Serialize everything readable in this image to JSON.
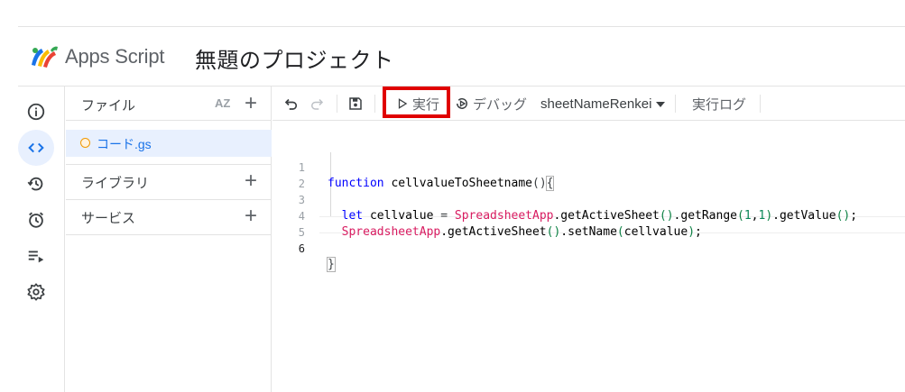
{
  "app": {
    "name": "Apps Script",
    "project_title": "無題のプロジェクト"
  },
  "rail": {
    "items": [
      {
        "icon": "info-icon",
        "active": false
      },
      {
        "icon": "code-editor-icon",
        "active": true
      },
      {
        "icon": "history-icon",
        "active": false
      },
      {
        "icon": "alarm-trigger-icon",
        "active": false
      },
      {
        "icon": "executions-icon",
        "active": false
      },
      {
        "icon": "settings-gear-icon",
        "active": false
      }
    ]
  },
  "files_panel": {
    "header_label": "ファイル",
    "sort_label": "AZ",
    "files": [
      {
        "name": "コード.gs",
        "selected": true
      }
    ],
    "sections": [
      {
        "label": "ライブラリ"
      },
      {
        "label": "サービス"
      }
    ]
  },
  "toolbar": {
    "run_label": "実行",
    "debug_label": "デバッグ",
    "function_name": "sheetNameRenkei",
    "log_label": "実行ログ",
    "highlight_color": "#e00000"
  },
  "code": {
    "line_numbers": [
      "1",
      "2",
      "3",
      "4",
      "5",
      "6"
    ],
    "current_line": 6,
    "l1_keyword": "function",
    "l1_name": "cellvalueToSheetname",
    "l1_paren": "()",
    "l1_brace": "{",
    "l3_let": "let",
    "l3_var": "cellvalue",
    "l3_eq": "=",
    "l3_class": "SpreadsheetApp",
    "l3_m1": ".getActiveSheet",
    "l3_p1": "()",
    "l3_m2": ".getRange",
    "l3_p2o": "(",
    "l3_n1": "1",
    "l3_comma": ",",
    "l3_n2": "1",
    "l3_p2c": ")",
    "l3_m3": ".getValue",
    "l3_p3": "()",
    "l3_semi": ";",
    "l4_class": "SpreadsheetApp",
    "l4_m1": ".getActiveSheet",
    "l4_p1": "()",
    "l4_m2": ".setName",
    "l4_p2o": "(",
    "l4_arg": "cellvalue",
    "l4_p2c": ")",
    "l4_semi": ";",
    "l6_brace": "}"
  }
}
